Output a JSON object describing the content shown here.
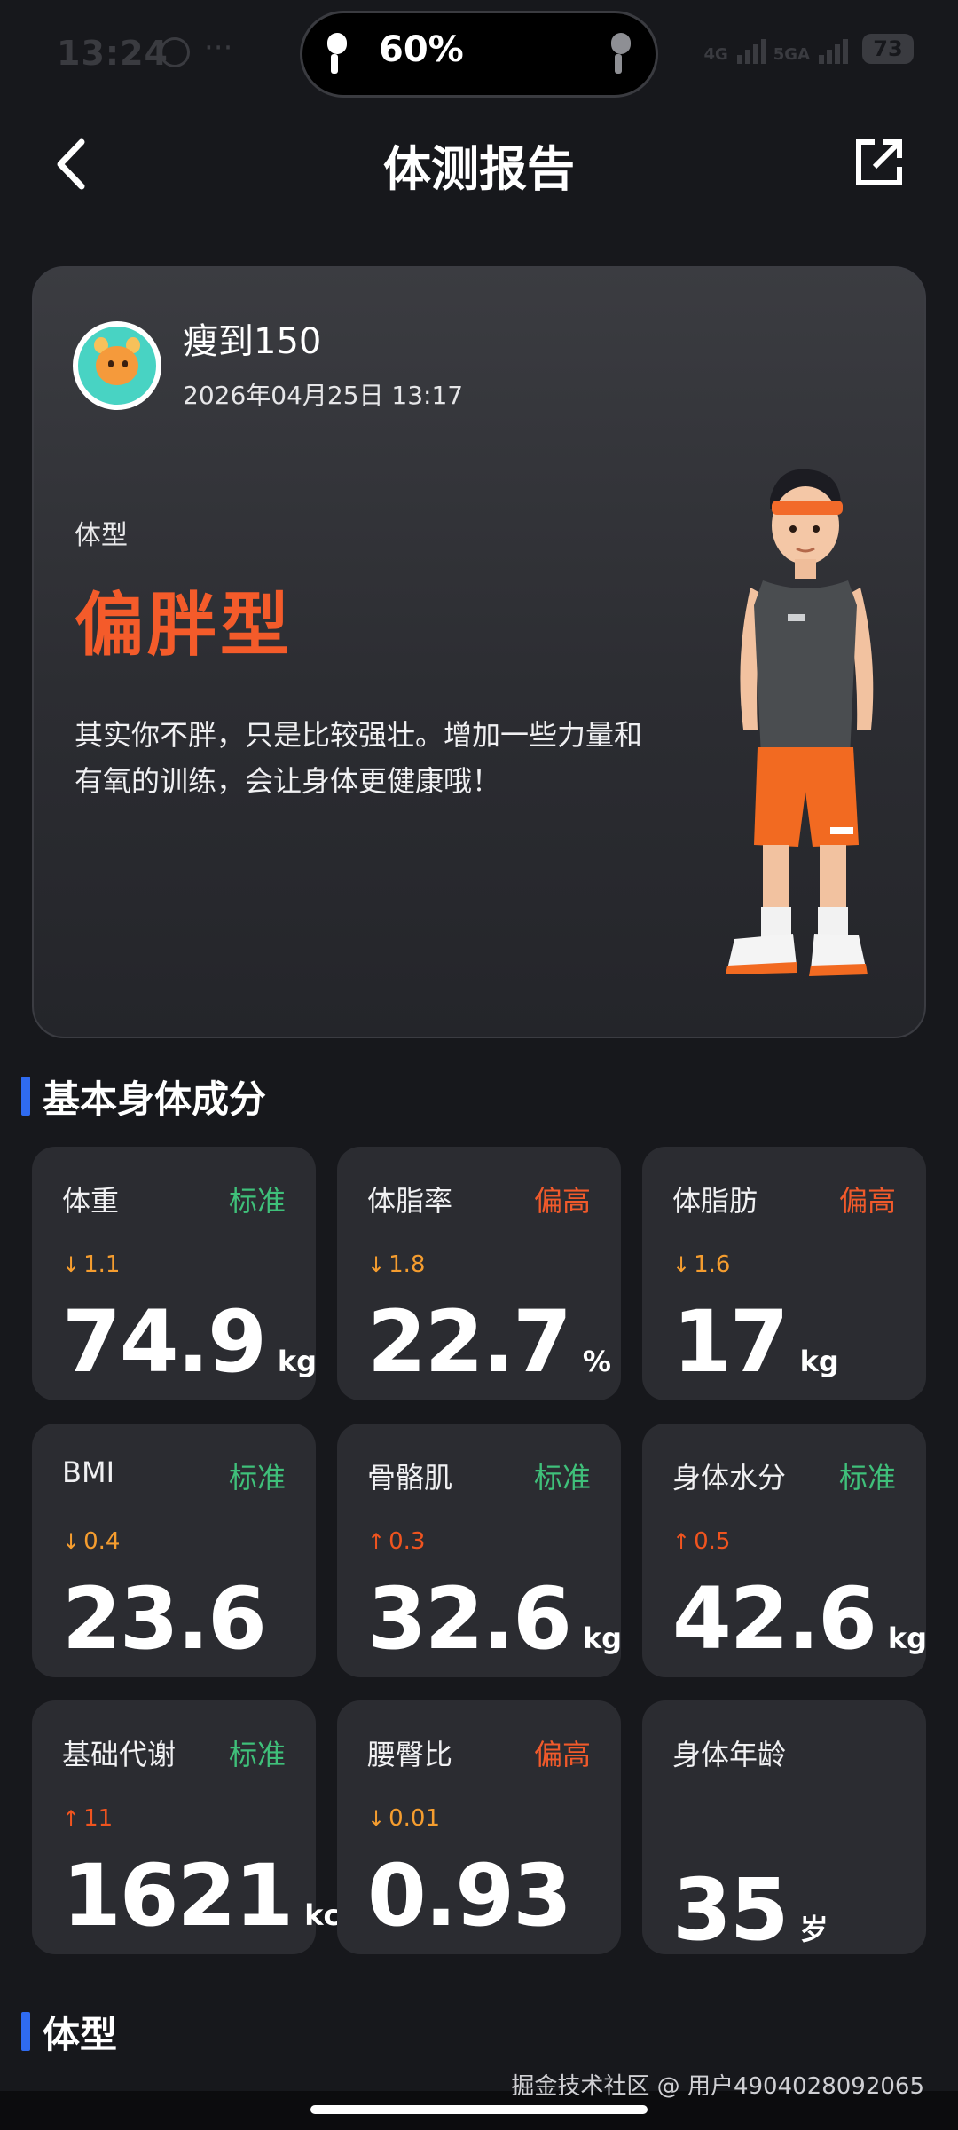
{
  "status_bar": {
    "time": "13:24",
    "dots": "···",
    "battery_pct_island": "60%",
    "net1": "4G",
    "net2": "5GA",
    "battery": "73"
  },
  "header": {
    "title": "体测报告"
  },
  "profile": {
    "username": "瘦到150",
    "datetime": "2026年04月25日 13:17",
    "body_type_label": "体型",
    "body_type_value": "偏胖型",
    "description": "其实你不胖，只是比较强壮。增加一些力量和有氧的训练，会让身体更健康哦！"
  },
  "sections": {
    "composition_title": "基本身体成分",
    "bodytype_title": "体型"
  },
  "metrics": [
    {
      "name": "体重",
      "status": "标准",
      "status_level": "standard",
      "direction": "down",
      "change": "1.1",
      "value": "74.9",
      "unit": "kg"
    },
    {
      "name": "体脂率",
      "status": "偏高",
      "status_level": "high",
      "direction": "down",
      "change": "1.8",
      "value": "22.7",
      "unit": "%"
    },
    {
      "name": "体脂肪",
      "status": "偏高",
      "status_level": "high",
      "direction": "down",
      "change": "1.6",
      "value": "17",
      "unit": "kg"
    },
    {
      "name": "BMI",
      "status": "标准",
      "status_level": "standard",
      "direction": "down",
      "change": "0.4",
      "value": "23.6",
      "unit": ""
    },
    {
      "name": "骨骼肌",
      "status": "标准",
      "status_level": "standard",
      "direction": "up",
      "change": "0.3",
      "value": "32.6",
      "unit": "kg"
    },
    {
      "name": "身体水分",
      "status": "标准",
      "status_level": "standard",
      "direction": "up",
      "change": "0.5",
      "value": "42.6",
      "unit": "kg"
    },
    {
      "name": "基础代谢",
      "status": "标准",
      "status_level": "standard",
      "direction": "up",
      "change": "11",
      "value": "1621",
      "unit": "kcal"
    },
    {
      "name": "腰臀比",
      "status": "偏高",
      "status_level": "high",
      "direction": "down",
      "change": "0.01",
      "value": "0.93",
      "unit": ""
    },
    {
      "name": "身体年龄",
      "status": "",
      "status_level": "",
      "direction": "",
      "change": "",
      "value": "35",
      "unit": "岁"
    }
  ],
  "watermark": "掘金技术社区 @ 用户4904028092065",
  "colors": {
    "background": "#17181c",
    "tile": "#2b2c31",
    "accent_orange": "#f45b2a",
    "standard_green": "#3fc07a",
    "section_blue": "#2f6bf0"
  },
  "icons": [
    "back-arrow-icon",
    "share-icon",
    "clock-icon",
    "earbud-icon",
    "signal-icon",
    "battery-icon"
  ]
}
